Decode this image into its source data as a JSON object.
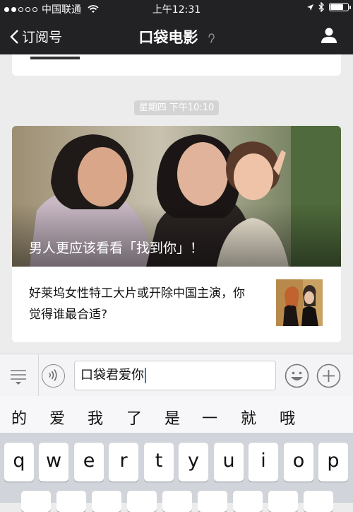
{
  "status": {
    "carrier": "中国联通",
    "time": "上午12:31",
    "signal_dots": 5,
    "signal_filled": 2
  },
  "nav": {
    "back_label": "订阅号",
    "title": "口袋电影"
  },
  "chat": {
    "timestamp": "星期四 下午10:10",
    "article": {
      "cover_caption": "男人更应该看看「找到你」！",
      "sub_title": "好莱坞女性特工大片或开除中国主演，你觉得谁最合适?"
    }
  },
  "input": {
    "text": "口袋君爱你"
  },
  "candidates": [
    "的",
    "爱",
    "我",
    "了",
    "是",
    "一",
    "就",
    "哦"
  ],
  "keyboard": {
    "row1": [
      "q",
      "w",
      "e",
      "r",
      "t",
      "y",
      "u",
      "i",
      "o",
      "p"
    ]
  },
  "colors": {
    "header_bg": "#222225",
    "chat_bg": "#ececec",
    "keyboard_bg": "#d1d4da",
    "caret": "#2d7be0"
  }
}
